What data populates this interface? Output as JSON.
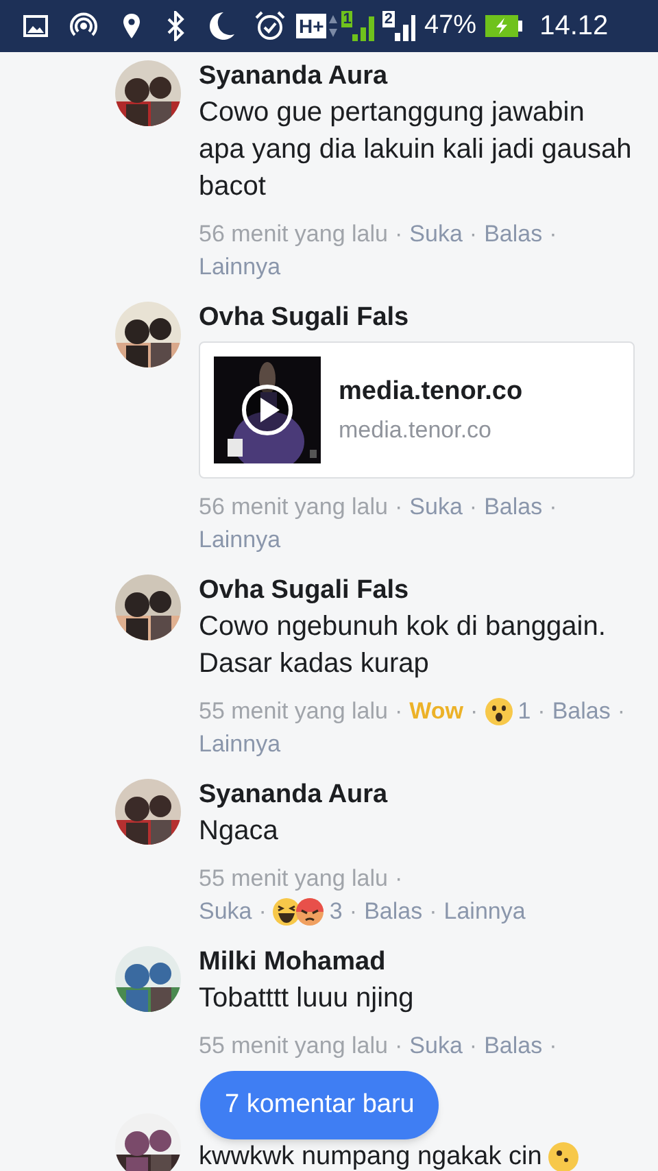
{
  "status_bar": {
    "network": "H+",
    "sim_1": "1",
    "sim_2": "2",
    "battery": "47%",
    "time": "14.12"
  },
  "comments": [
    {
      "avatar": {
        "kind": "picture"
      },
      "name": "Syananda Aura",
      "body": "Cowo gue pertanggung jawabin apa yang dia lakuin kali jadi gausah bacot",
      "meta_lines": [
        [
          {
            "kind": "time",
            "text": "56 menit yang lalu"
          },
          {
            "kind": "sep",
            "text": "·"
          },
          {
            "kind": "link",
            "text": "Suka"
          },
          {
            "kind": "sep",
            "text": "·"
          },
          {
            "kind": "link",
            "text": "Balas"
          },
          {
            "kind": "sep",
            "text": "·"
          }
        ],
        [
          {
            "kind": "link",
            "text": "Lainnya"
          }
        ]
      ]
    },
    {
      "avatar": {
        "kind": "picture"
      },
      "name": "Ovha Sugali Fals",
      "attachment": {
        "kind": "picture",
        "title": "media.tenor.co",
        "domain": "media.tenor.co"
      },
      "meta_lines": [
        [
          {
            "kind": "time",
            "text": "56 menit yang lalu"
          },
          {
            "kind": "sep",
            "text": "·"
          },
          {
            "kind": "link",
            "text": "Suka"
          },
          {
            "kind": "sep",
            "text": "·"
          },
          {
            "kind": "link",
            "text": "Balas"
          },
          {
            "kind": "sep",
            "text": "·"
          }
        ],
        [
          {
            "kind": "link",
            "text": "Lainnya"
          }
        ]
      ]
    },
    {
      "avatar": {
        "kind": "picture"
      },
      "name": "Ovha Sugali Fals",
      "body": "Cowo ngebunuh kok di banggain. Dasar kadas kurap",
      "meta_lines": [
        [
          {
            "kind": "time",
            "text": "55 menit yang lalu"
          },
          {
            "kind": "sep",
            "text": "·"
          },
          {
            "kind": "reacted",
            "text": "Wow"
          },
          {
            "kind": "sep",
            "text": "·"
          },
          {
            "kind": "reactions",
            "emojis": [
              {
                "kind": "wow"
              }
            ],
            "text": "1"
          },
          {
            "kind": "sep",
            "text": "·"
          },
          {
            "kind": "link",
            "text": "Balas"
          },
          {
            "kind": "sep",
            "text": "·"
          }
        ],
        [
          {
            "kind": "link",
            "text": "Lainnya"
          }
        ]
      ]
    },
    {
      "avatar": {
        "kind": "picture"
      },
      "name": "Syananda Aura",
      "body": "Ngaca",
      "meta_lines": [
        [
          {
            "kind": "time",
            "text": "55 menit yang lalu"
          },
          {
            "kind": "sep",
            "text": "·"
          }
        ],
        [
          {
            "kind": "link",
            "text": "Suka"
          },
          {
            "kind": "sep",
            "text": "·"
          },
          {
            "kind": "reactions",
            "emojis": [
              {
                "kind": "haha"
              },
              {
                "kind": "angry"
              }
            ],
            "text": "3"
          },
          {
            "kind": "sep",
            "text": "·"
          },
          {
            "kind": "link",
            "text": "Balas"
          },
          {
            "kind": "sep",
            "text": "·"
          },
          {
            "kind": "link",
            "text": "Lainnya"
          }
        ]
      ]
    },
    {
      "avatar": {
        "kind": "picture"
      },
      "name": "Milki Mohamad",
      "body": "Tobatttt luuu njing",
      "meta_lines": [
        [
          {
            "kind": "time",
            "text": "55 menit yang lalu"
          },
          {
            "kind": "sep",
            "text": "·"
          },
          {
            "kind": "link",
            "text": "Suka"
          },
          {
            "kind": "sep",
            "text": "·"
          },
          {
            "kind": "link",
            "text": "Balas"
          },
          {
            "kind": "sep",
            "text": "·"
          }
        ]
      ]
    },
    {
      "avatar": {
        "kind": "picture"
      },
      "body": "kwwkwk numpang ngakak cin",
      "body_emoji": {
        "kind": "grin"
      }
    }
  ],
  "new_comments_button": "7 komentar baru"
}
